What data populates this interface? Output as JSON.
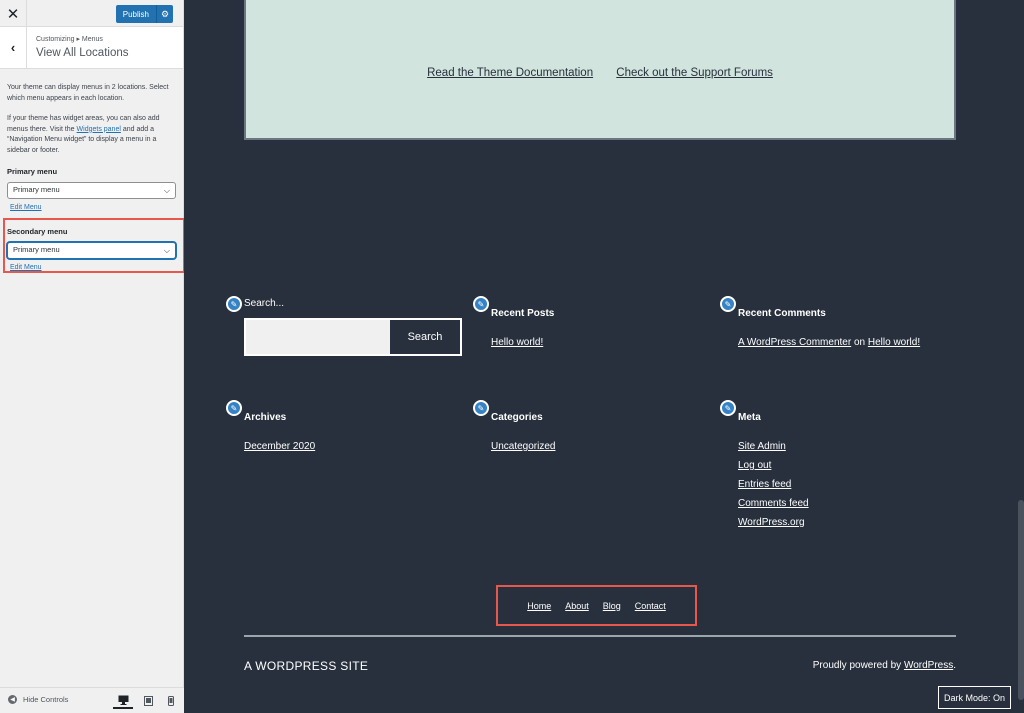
{
  "sidebar": {
    "close_icon": "close-icon",
    "publish_label": "Publish",
    "breadcrumb": "Customizing ▸ Menus",
    "title": "View All Locations",
    "intro": "Your theme can display menus in 2 locations. Select which menu appears in each location.",
    "widget_text_before": "If your theme has widget areas, you can also add menus there. Visit the ",
    "widget_link": "Widgets panel",
    "widget_text_after": " and add a “Navigation Menu widget” to display a menu in a sidebar or footer.",
    "locations": [
      {
        "label": "Primary menu",
        "selected": "Primary menu",
        "edit_label": "Edit Menu"
      },
      {
        "label": "Secondary menu",
        "selected": "Primary menu",
        "edit_label": "Edit Menu"
      }
    ],
    "hide_controls_label": "Hide Controls"
  },
  "preview": {
    "green_links": [
      "Read the Theme Documentation",
      "Check out the Support Forums"
    ],
    "search": {
      "label": "Search...",
      "button": "Search"
    },
    "recent_posts": {
      "title": "Recent Posts",
      "items": [
        "Hello world!"
      ]
    },
    "recent_comments": {
      "title": "Recent Comments",
      "author": "A WordPress Commenter",
      "on": " on ",
      "post": "Hello world!"
    },
    "archives": {
      "title": "Archives",
      "items": [
        "December 2020"
      ]
    },
    "categories": {
      "title": "Categories",
      "items": [
        "Uncategorized"
      ]
    },
    "meta": {
      "title": "Meta",
      "items": [
        "Site Admin",
        "Log out",
        "Entries feed",
        "Comments feed",
        "WordPress.org"
      ]
    },
    "footer_menu": [
      "Home",
      "About",
      "Blog",
      "Contact"
    ],
    "site_name": "A WORDPRESS SITE",
    "powered_prefix": "Proudly powered by ",
    "powered_link": "WordPress",
    "powered_suffix": ".",
    "dark_mode": "Dark Mode: On"
  },
  "colors": {
    "accent": "#2271b1",
    "highlight": "#e7574b",
    "preview_bg": "#28303d",
    "green_box": "#d1e4dd"
  }
}
